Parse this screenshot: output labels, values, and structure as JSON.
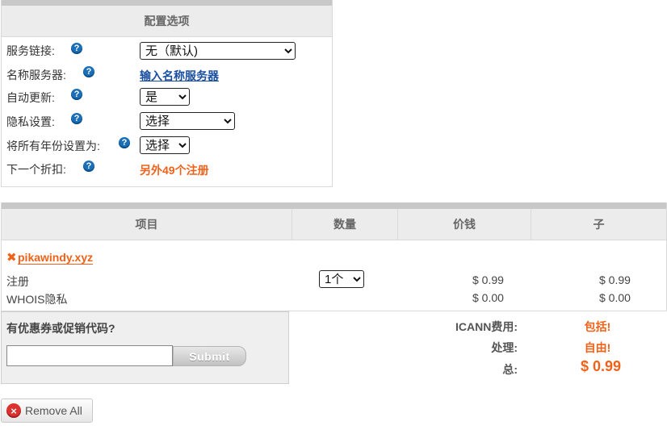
{
  "config": {
    "header": "配置选项",
    "rows": [
      {
        "label": "服务链接:",
        "value": "无（默认)"
      },
      {
        "label": "名称服务器:",
        "value": "输入名称服务器"
      },
      {
        "label": "自动更新:",
        "value": "是"
      },
      {
        "label": "隐私设置:",
        "value": "选择"
      },
      {
        "label": "将所有年份设置为:",
        "value": "选择"
      },
      {
        "label": "下一个折扣:",
        "value": "另外49个注册"
      }
    ],
    "help_glyph": "?"
  },
  "cart": {
    "headers": [
      "项目",
      "数量",
      "价钱",
      "子"
    ],
    "domain": "pikawindy.xyz",
    "remove_glyph": "✖",
    "quantity": "1个",
    "lines": [
      {
        "label": "注册",
        "price": "$ 0.99",
        "subtotal": "$ 0.99"
      },
      {
        "label": "WHOIS隐私",
        "price": "$ 0.00",
        "subtotal": "$ 0.00"
      }
    ]
  },
  "coupon": {
    "title": "有优惠券或促销代码?",
    "input_value": "",
    "submit_label": "Submit"
  },
  "totals": {
    "icann_label": "ICANN费用:",
    "icann_value": "包括!",
    "handling_label": "处理:",
    "handling_value": "自由!",
    "total_label": "总:",
    "total_value": "$ 0.99"
  },
  "remove_all": {
    "label": "Remove All",
    "icon_glyph": "×"
  },
  "colors": {
    "accent": "#f0621a",
    "link": "#1a4fa0",
    "help_icon": "#1a6fb6",
    "remove_icon": "#d9322f"
  }
}
